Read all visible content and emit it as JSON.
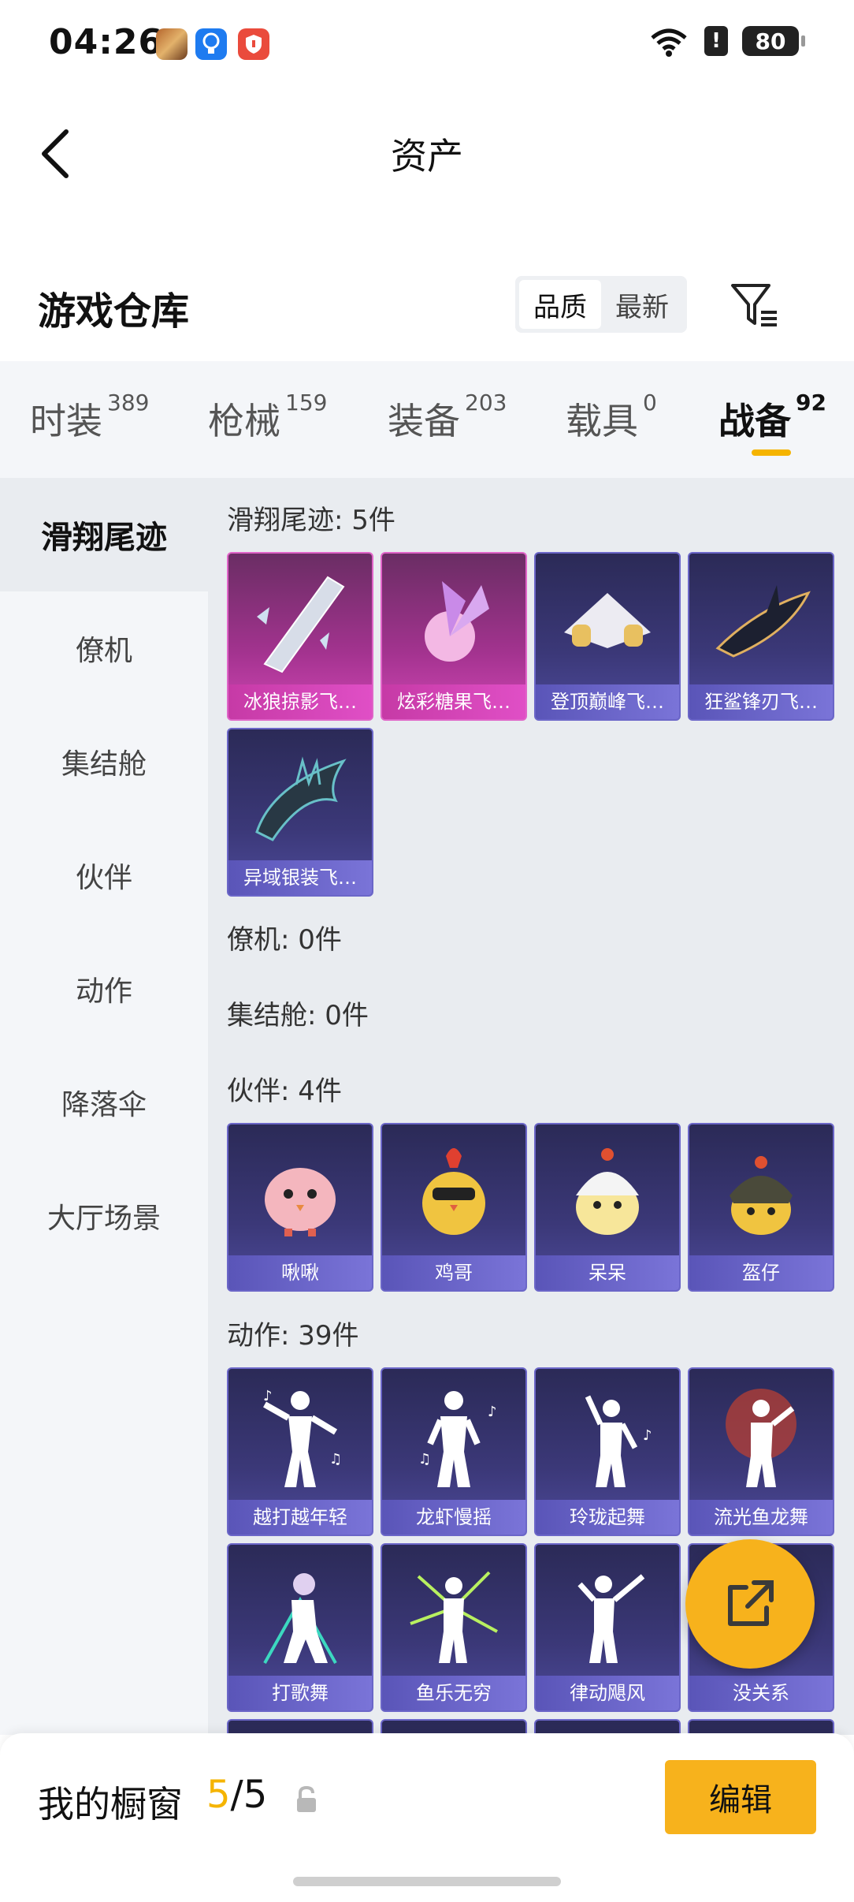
{
  "status_bar": {
    "time": "04:26",
    "battery": "80",
    "alert": "!"
  },
  "header": {
    "title": "资产"
  },
  "section": {
    "title": "游戏仓库"
  },
  "sort": {
    "options": [
      "品质",
      "最新"
    ],
    "active": "品质"
  },
  "tabs": [
    {
      "label": "时装",
      "count": "389"
    },
    {
      "label": "枪械",
      "count": "159"
    },
    {
      "label": "装备",
      "count": "203"
    },
    {
      "label": "载具",
      "count": "0"
    },
    {
      "label": "战备",
      "count": "92",
      "active": true
    }
  ],
  "side_nav": [
    "滑翔尾迹",
    "僚机",
    "集结舱",
    "伙伴",
    "动作",
    "降落伞",
    "大厅场景"
  ],
  "groups": {
    "glide": {
      "label": "滑翔尾迹: 5件",
      "items": [
        "冰狼掠影飞…",
        "炫彩糖果飞…",
        "登顶巅峰飞…",
        "狂鲨锋刃飞…",
        "异域银装飞…"
      ]
    },
    "wingman": {
      "label": "僚机: 0件"
    },
    "pod": {
      "label": "集结舱: 0件"
    },
    "partner": {
      "label": "伙伴: 4件",
      "items": [
        "啾啾",
        "鸡哥",
        "呆呆",
        "盔仔"
      ]
    },
    "emote": {
      "label": "动作: 39件",
      "items": [
        "越打越年轻",
        "龙虾慢摇",
        "玲珑起舞",
        "流光鱼龙舞",
        "打歌舞",
        "鱼乐无穷",
        "律动飓风",
        "没关系"
      ]
    }
  },
  "bottom": {
    "label": "我的橱窗",
    "current": "5",
    "total": "/5",
    "edit": "编辑"
  },
  "colors": {
    "accent": "#f5b400",
    "pink_card": "#a3338f",
    "purple_card": "#3b3878"
  }
}
